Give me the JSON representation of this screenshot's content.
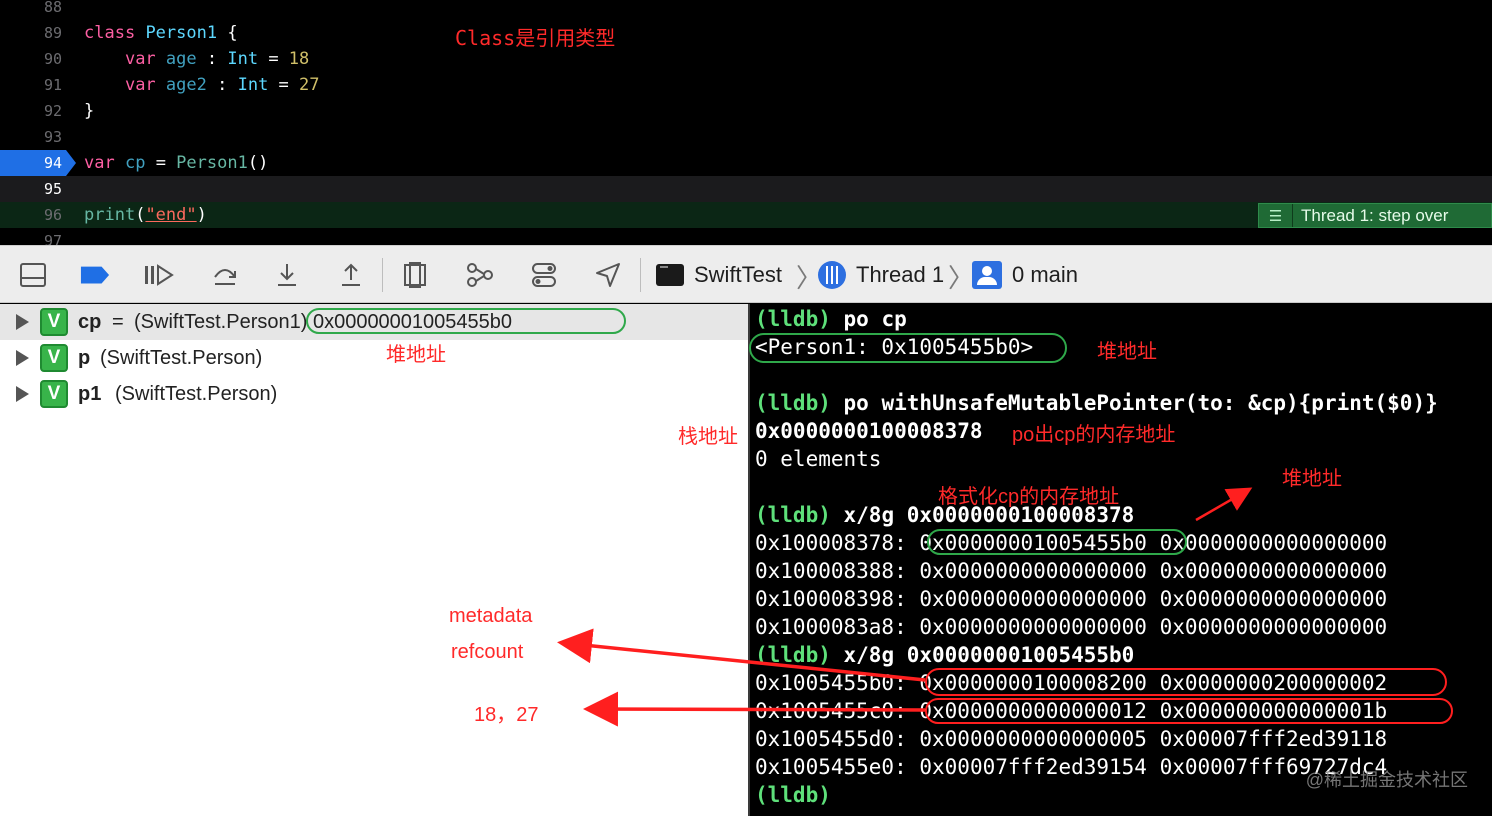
{
  "editor": {
    "lines": [
      {
        "num": "88",
        "tokens": []
      },
      {
        "num": "89",
        "tokens": [
          {
            "t": "class",
            "c": "kw"
          },
          {
            "t": " ",
            "c": "pl"
          },
          {
            "t": "Person1",
            "c": "cls"
          },
          {
            "t": " {",
            "c": "pl"
          }
        ]
      },
      {
        "num": "90",
        "tokens": [
          {
            "t": "    ",
            "c": "pl"
          },
          {
            "t": "var",
            "c": "kw"
          },
          {
            "t": " ",
            "c": "pl"
          },
          {
            "t": "age",
            "c": "vb"
          },
          {
            "t": " : ",
            "c": "pl"
          },
          {
            "t": "Int",
            "c": "ty"
          },
          {
            "t": " = ",
            "c": "pl"
          },
          {
            "t": "18",
            "c": "num"
          }
        ]
      },
      {
        "num": "91",
        "tokens": [
          {
            "t": "    ",
            "c": "pl"
          },
          {
            "t": "var",
            "c": "kw"
          },
          {
            "t": " ",
            "c": "pl"
          },
          {
            "t": "age2",
            "c": "vb"
          },
          {
            "t": " : ",
            "c": "pl"
          },
          {
            "t": "Int",
            "c": "ty"
          },
          {
            "t": " = ",
            "c": "pl"
          },
          {
            "t": "27",
            "c": "num"
          }
        ]
      },
      {
        "num": "92",
        "tokens": [
          {
            "t": "}",
            "c": "pl"
          }
        ]
      },
      {
        "num": "93",
        "tokens": []
      },
      {
        "num": "94",
        "tokens": [
          {
            "t": "var",
            "c": "kw"
          },
          {
            "t": " ",
            "c": "pl"
          },
          {
            "t": "cp",
            "c": "vb"
          },
          {
            "t": " = ",
            "c": "pl"
          },
          {
            "t": "Person1",
            "c": "fn"
          },
          {
            "t": "()",
            "c": "pl"
          }
        ]
      },
      {
        "num": "95",
        "tokens": []
      },
      {
        "num": "96",
        "tokens": [
          {
            "t": "print",
            "c": "fn"
          },
          {
            "t": "(",
            "c": "pl"
          },
          {
            "t": "\"end\"",
            "c": "str"
          },
          {
            "t": ")",
            "c": "pl"
          }
        ]
      },
      {
        "num": "97",
        "tokens": []
      }
    ],
    "annotation": "Class是引用类型",
    "thread_pill": "Thread 1: step over"
  },
  "toolbar": {
    "target": "SwiftTest",
    "thread": "Thread 1",
    "frame": "0 main"
  },
  "variables": [
    {
      "name": "cp",
      "eq": "=",
      "type": "(SwiftTest.Person1) 0x00000001005455b0",
      "selected": true
    },
    {
      "name": "p",
      "eq": "",
      "type": "(SwiftTest.Person)",
      "selected": false
    },
    {
      "name": "p1",
      "eq": "",
      "type": "(SwiftTest.Person)",
      "selected": false
    }
  ],
  "console": {
    "prompt": "(lldb)",
    "cmd1": "po cp",
    "out1": "<Person1: 0x1005455b0>",
    "cmd2": "po withUnsafeMutablePointer(to: &cp){print($0)}",
    "out2": "0x0000000100008378",
    "out3": "0 elements",
    "cmd3": "x/8g 0x0000000100008378",
    "mem1": [
      {
        "addr": "0x100008378:",
        "a": "0x00000001005455b0",
        "b": "0x0000000000000000"
      },
      {
        "addr": "0x100008388:",
        "a": "0x0000000000000000",
        "b": "0x0000000000000000"
      },
      {
        "addr": "0x100008398:",
        "a": "0x0000000000000000",
        "b": "0x0000000000000000"
      },
      {
        "addr": "0x1000083a8:",
        "a": "0x0000000000000000",
        "b": "0x0000000000000000"
      }
    ],
    "cmd4": "x/8g 0x00000001005455b0",
    "mem2": [
      {
        "addr": "0x1005455b0:",
        "a": "0x0000000100008200",
        "b": "0x0000000200000002"
      },
      {
        "addr": "0x1005455c0:",
        "a": "0x0000000000000012",
        "b": "0x000000000000001b"
      },
      {
        "addr": "0x1005455d0:",
        "a": "0x0000000000000005",
        "b": "0x00007fff2ed39118"
      },
      {
        "addr": "0x1005455e0:",
        "a": "0x00007fff2ed39154",
        "b": "0x00007fff69727dc4"
      }
    ]
  },
  "annotations": {
    "heap_addr_vars": "堆地址",
    "heap_addr_console": "堆地址",
    "stack_addr": "栈地址",
    "po_out_note": "po出cp的内存地址",
    "format_note": "格式化cp的内存地址",
    "heap_addr_arrow": "堆地址",
    "metadata": "metadata",
    "refcount": "refcount",
    "values": "18，27"
  },
  "watermark": "@稀土掘金技术社区",
  "colors": {
    "keyword": "#fc5fa3",
    "type": "#5dd8ff",
    "function": "#67b7a4",
    "number": "#d0bf69",
    "string": "#fc6a5d",
    "lldb_prompt": "#5ee07a",
    "annotation_red": "#ff2a2a",
    "oval_green": "#2fa84a",
    "breakpoint_blue": "#1f6fe5"
  }
}
